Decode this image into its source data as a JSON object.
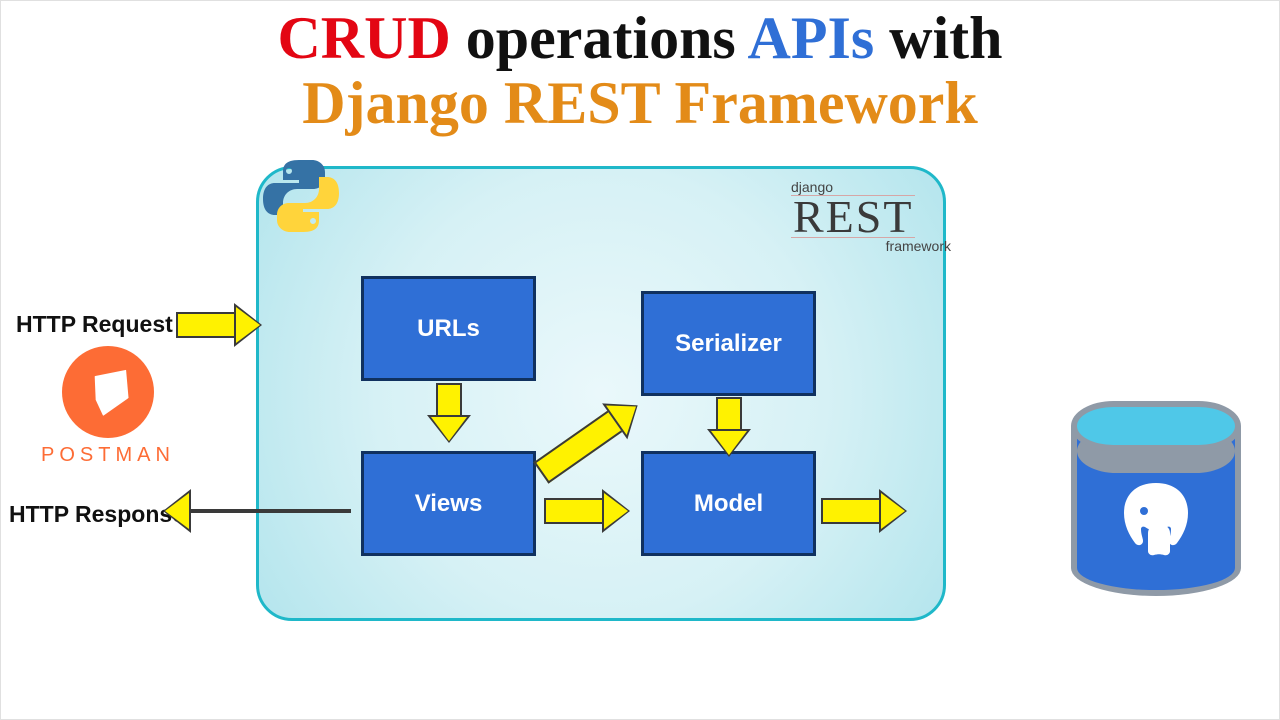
{
  "title": {
    "crud": "CRUD",
    "operations": " operations ",
    "apis": "APIs",
    "with": " with",
    "line2": "Django REST Framework"
  },
  "labels": {
    "http_request": "HTTP Request",
    "http_response": "HTTP Response"
  },
  "nodes": {
    "urls": "URLs",
    "views": "Views",
    "serializer": "Serializer",
    "model": "Model"
  },
  "postman": {
    "label": "POSTMAN"
  },
  "drf": {
    "top": "django",
    "mid": "REST",
    "bottom": "framework"
  },
  "icons": {
    "python": "python-logo",
    "postman": "postman-logo",
    "postgres": "postgresql-elephant"
  },
  "colors": {
    "accent_red": "#e30613",
    "accent_blue": "#2f6fd6",
    "accent_orange": "#e38b18",
    "arrow_fill": "#fff200",
    "container_border": "#1fb8c9",
    "postman": "#fd6c35"
  }
}
